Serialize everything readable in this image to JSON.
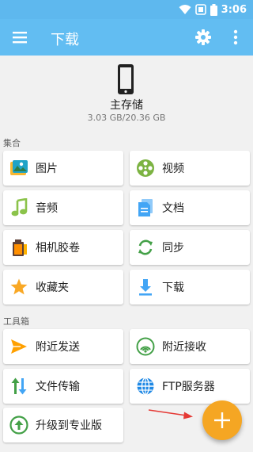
{
  "status_bar": {
    "time": "3:06",
    "icons": [
      "wifi-icon",
      "sim-card-icon",
      "battery-icon"
    ],
    "background": "#5eb8ee"
  },
  "app_bar": {
    "title": "下载",
    "menu_icon": "hamburger-menu-icon",
    "settings_icon": "gear-icon",
    "more_icon": "more-vert-icon",
    "background": "#62bdf2"
  },
  "storage": {
    "icon": "phone-icon",
    "name": "主存储",
    "usage": "3.03 GB/20.36 GB"
  },
  "collections": {
    "label": "集合",
    "items": [
      {
        "label": "图片",
        "icon": "pictures-icon"
      },
      {
        "label": "视频",
        "icon": "film-reel-icon"
      },
      {
        "label": "音频",
        "icon": "music-note-icon"
      },
      {
        "label": "文档",
        "icon": "document-icon"
      },
      {
        "label": "相机胶卷",
        "icon": "camera-roll-icon"
      },
      {
        "label": "同步",
        "icon": "sync-icon"
      },
      {
        "label": "收藏夹",
        "icon": "star-icon"
      },
      {
        "label": "下载",
        "icon": "download-icon"
      }
    ]
  },
  "toolbox": {
    "label": "工具箱",
    "items": [
      {
        "label": "附近发送",
        "icon": "send-icon"
      },
      {
        "label": "附近接收",
        "icon": "receive-signal-icon"
      },
      {
        "label": "文件传输",
        "icon": "transfer-icon"
      },
      {
        "label": "FTP服务器",
        "icon": "globe-icon"
      },
      {
        "label": "升级到专业版",
        "icon": "upgrade-icon"
      }
    ]
  },
  "fab": {
    "icon": "plus-icon",
    "color": "#f5a623"
  },
  "annotation": {
    "icon": "red-arrow-icon",
    "color": "#e53935"
  }
}
